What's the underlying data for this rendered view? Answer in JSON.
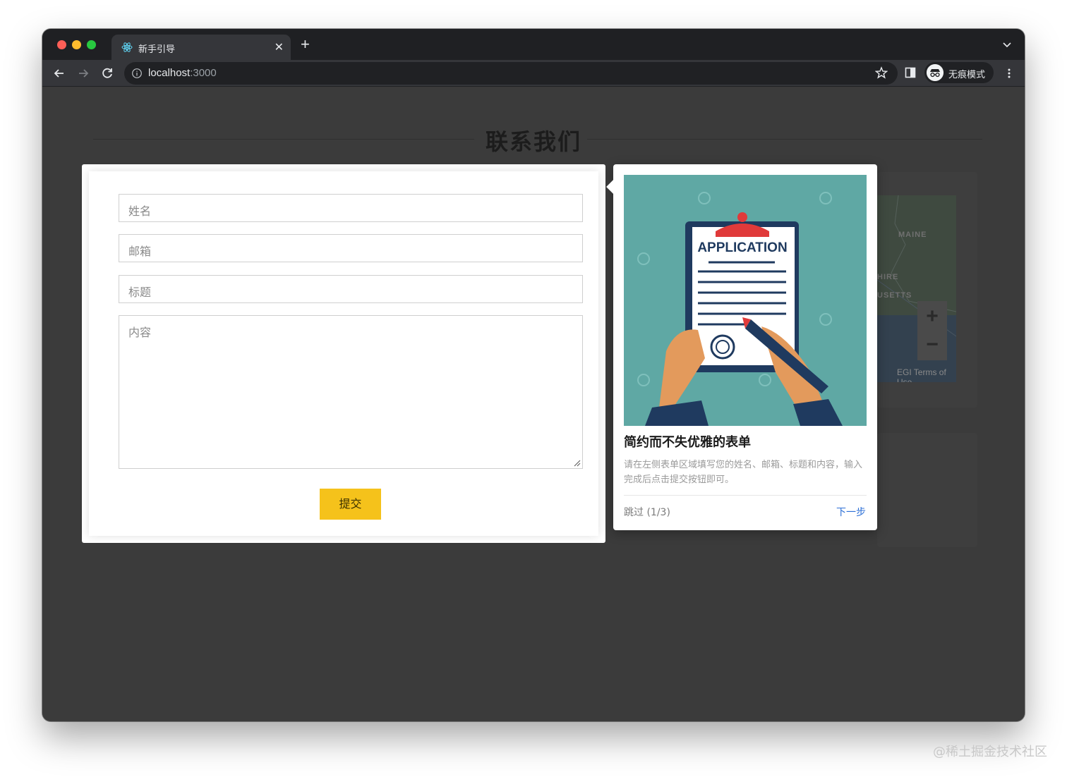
{
  "browser": {
    "tab_title": "新手引导",
    "url_host": "localhost",
    "url_port": ":3000",
    "profile_label": "无痕模式"
  },
  "page": {
    "heading": "联系我们",
    "form": {
      "name_placeholder": "姓名",
      "email_placeholder": "邮箱",
      "subject_placeholder": "标题",
      "content_placeholder": "内容",
      "submit_label": "提交"
    },
    "map": {
      "label_maine": "MAINE",
      "label_hire": "HIRE",
      "label_usetts": "USETTS",
      "zoom_in": "+",
      "zoom_out": "−",
      "attribution": "EGI   Terms of Use"
    }
  },
  "tour": {
    "image_heading": "APPLICATION",
    "title": "简约而不失优雅的表单",
    "description": "请在左侧表单区域填写您的姓名、邮箱、标题和内容，输入完成后点击提交按钮即可。",
    "skip_label": "跳过 (1/3)",
    "next_label": "下一步"
  },
  "watermark": "@稀土掘金技术社区",
  "colors": {
    "accent_button": "#f5c21b",
    "link": "#2c6fd6",
    "illustration_bg": "#5fa8a4"
  }
}
